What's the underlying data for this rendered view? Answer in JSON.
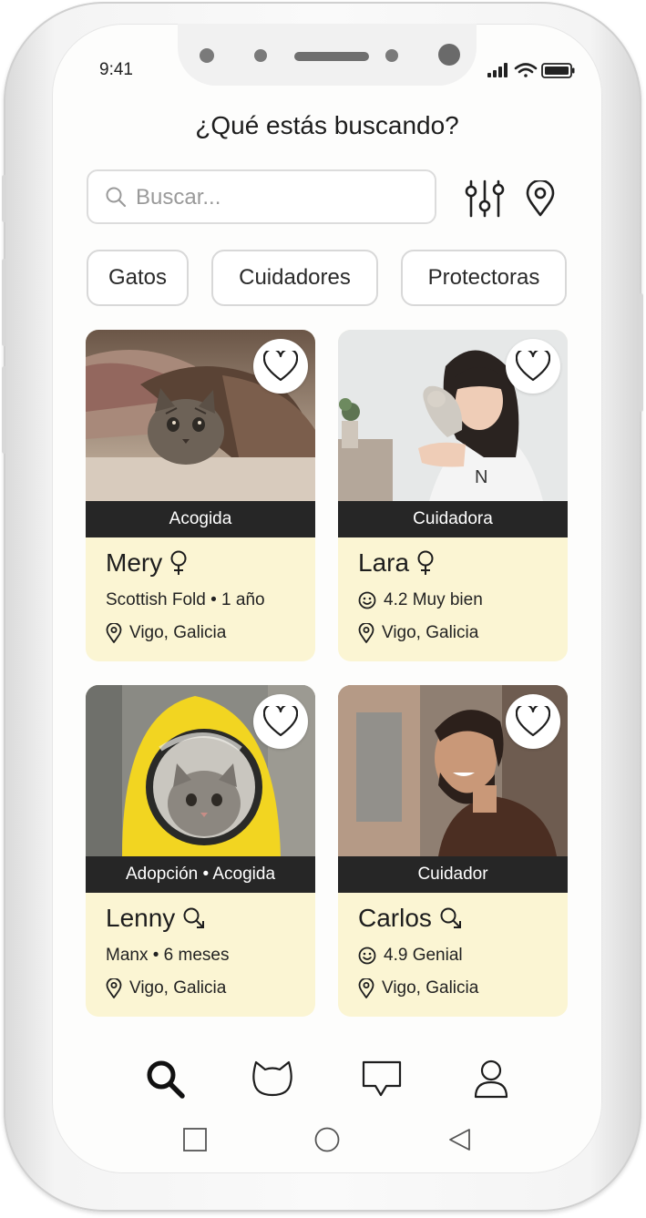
{
  "status": {
    "time": "9:41"
  },
  "header": {
    "title": "¿Qué estás buscando?"
  },
  "search": {
    "placeholder": "Buscar..."
  },
  "filters": [
    "Gatos",
    "Cuidadores",
    "Protectoras"
  ],
  "cards": [
    {
      "band": "Acogida",
      "name": "Mery",
      "gender_icon": "female-icon",
      "info": "Scottish Fold • 1 año",
      "info_icon": null,
      "location": "Vigo, Galicia"
    },
    {
      "band": "Cuidadora",
      "name": "Lara",
      "gender_icon": "female-icon",
      "info": "4.2 Muy bien",
      "info_icon": "smiley-icon",
      "location": "Vigo, Galicia"
    },
    {
      "band": "Adopción • Acogida",
      "name": "Lenny",
      "gender_icon": "male-icon",
      "info": "Manx • 6 meses",
      "info_icon": null,
      "location": "Vigo, Galicia"
    },
    {
      "band": "Cuidador",
      "name": "Carlos",
      "gender_icon": "male-icon",
      "info": "4.9 Genial",
      "info_icon": "smiley-icon",
      "location": "Vigo, Galicia"
    }
  ],
  "tabs": [
    "search-icon",
    "cat-icon",
    "chat-icon",
    "user-icon"
  ],
  "colors": {
    "card_bg": "#fbf5d3",
    "band_bg": "#262626",
    "accent": "#1d1d1d"
  }
}
